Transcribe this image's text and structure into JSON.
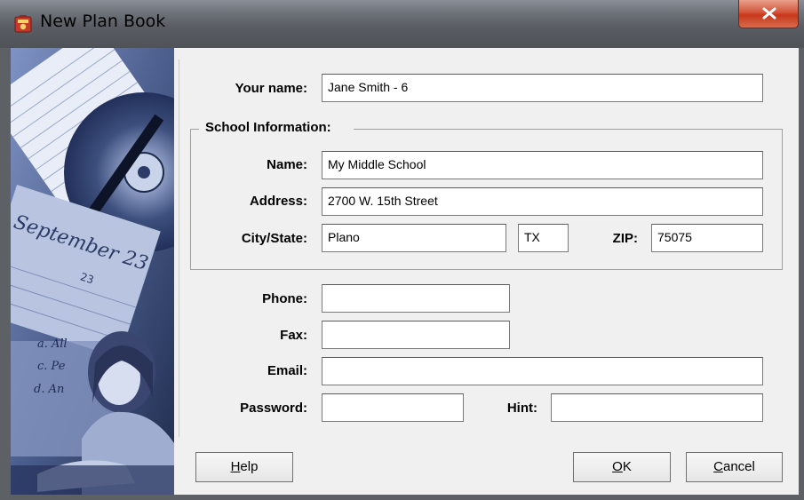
{
  "window": {
    "title": "New Plan Book"
  },
  "form": {
    "your_name_label": "Your name:",
    "your_name_value": "Jane Smith - 6",
    "school_group_title": "School Information:",
    "school_name_label": "Name:",
    "school_name_value": "My Middle School",
    "address_label": "Address:",
    "address_value": "2700 W. 15th Street",
    "city_state_label": "City/State:",
    "city_value": "Plano",
    "state_value": "TX",
    "zip_label": "ZIP:",
    "zip_value": "75075",
    "phone_label": "Phone:",
    "phone_value": "",
    "fax_label": "Fax:",
    "fax_value": "",
    "email_label": "Email:",
    "email_value": "",
    "password_label": "Password:",
    "password_value": "",
    "hint_label": "Hint:",
    "hint_value": ""
  },
  "buttons": {
    "help_mnemonic": "H",
    "help_rest": "elp",
    "ok_mnemonic": "O",
    "ok_rest": "K",
    "cancel_mnemonic": "C",
    "cancel_rest": "ancel"
  },
  "side_image": {
    "calendar_month": "September 23",
    "calendar_day": "23",
    "notebook_lines": [
      "a. All",
      "c. Pe",
      "d. An"
    ]
  },
  "icons": {
    "app": "plan-book-app-icon",
    "close": "close-icon"
  },
  "colors": {
    "title_bar": "#5a5e64",
    "close_button": "#c7371b",
    "image_tint": "#4a5d8c",
    "dialog_background": "#f0f0f0"
  }
}
